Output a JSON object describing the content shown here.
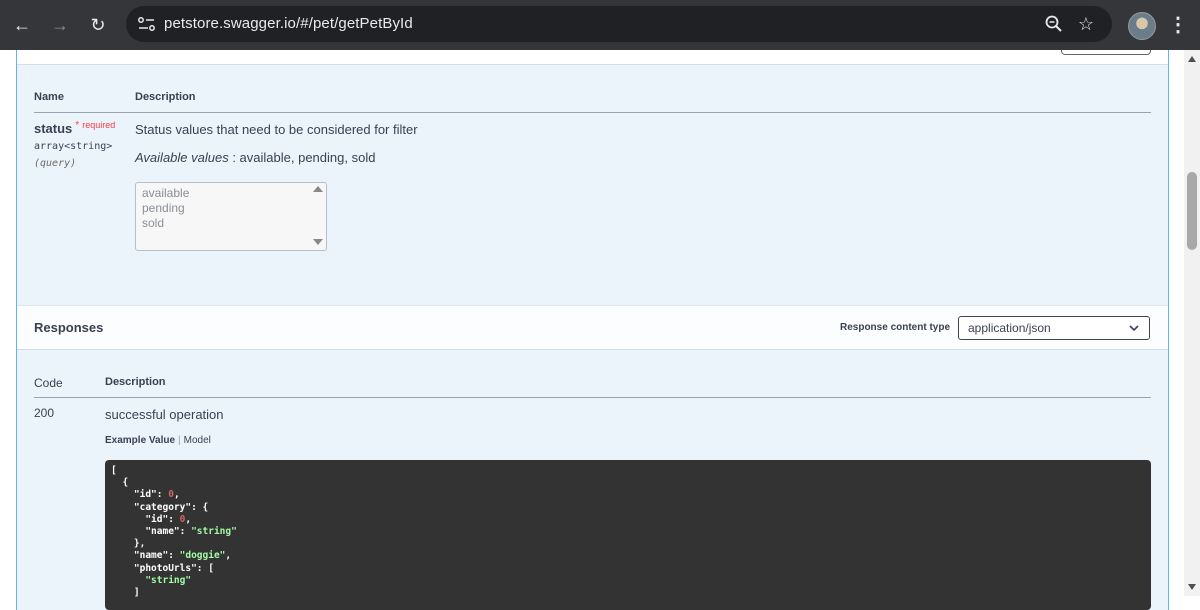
{
  "browser": {
    "url": "petstore.swagger.io/#/pet/getPetById",
    "back_icon": "←",
    "forward_icon": "→",
    "reload_icon": "↻",
    "zoom_icon": "🔍",
    "bookmark_icon": "☆",
    "menu_icon": "⋮"
  },
  "parameters": {
    "col_name": "Name",
    "col_description": "Description",
    "param": {
      "name": "status",
      "required_star": "*",
      "required_label": "required",
      "type": "array<string>",
      "location": "(query)",
      "description": "Status values that need to be considered for filter",
      "available_label": "Available values",
      "available_values": " : available, pending, sold",
      "options": [
        "available",
        "pending",
        "sold"
      ]
    }
  },
  "responses": {
    "title": "Responses",
    "content_type_label": "Response content type",
    "content_type_value": "application/json",
    "col_code": "Code",
    "col_description": "Description",
    "code": "200",
    "code_description": "successful operation",
    "tab_example": "Example Value",
    "tab_model": "Model",
    "example_lines": [
      {
        "t": "["
      },
      {
        "t": "  {"
      },
      {
        "k": "    \"id\"",
        "v": "0",
        "vt": "num",
        "s": ","
      },
      {
        "k": "    \"category\"",
        "v": "{",
        "vt": "plain",
        "s": ""
      },
      {
        "k": "      \"id\"",
        "v": "0",
        "vt": "num",
        "s": ","
      },
      {
        "k": "      \"name\"",
        "v": "\"string\"",
        "vt": "str",
        "s": ""
      },
      {
        "t": "    },"
      },
      {
        "k": "    \"name\"",
        "v": "\"doggie\"",
        "vt": "str",
        "s": ","
      },
      {
        "k": "    \"photoUrls\"",
        "v": "[",
        "vt": "plain",
        "s": ""
      },
      {
        "t": "      ",
        "v": "\"string\"",
        "vt": "str"
      },
      {
        "t": "    ]"
      }
    ]
  },
  "colors": {
    "opblock_bg": "#ebf3fb",
    "opblock_border": "#61affe",
    "required": "#f93e3e",
    "code_bg": "#333333",
    "json_number": "#d36363",
    "json_string": "#a2fca2"
  }
}
